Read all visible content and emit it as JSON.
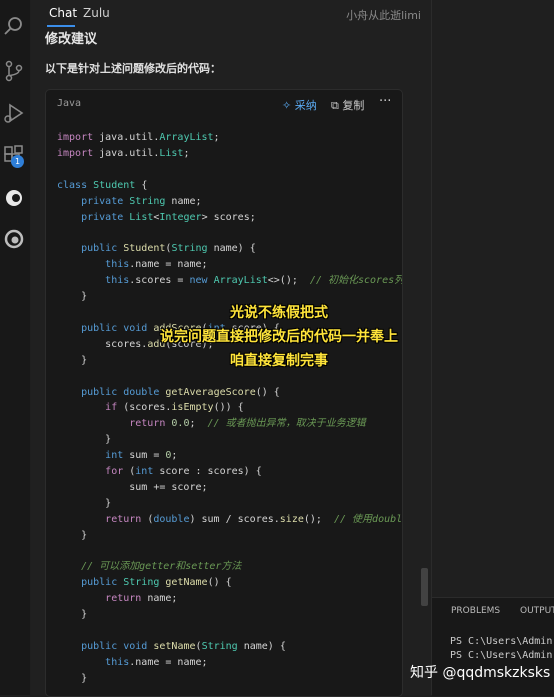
{
  "tabs": {
    "chat": "Chat",
    "zulu": "Zulu",
    "user": "小舟从此逝limi"
  },
  "chat": {
    "heading": "修改建议",
    "intro": "以下是针对上述问题修改后的代码：",
    "card": {
      "language": "Java",
      "apply": "采纳",
      "copy": "复制",
      "more": "···"
    }
  },
  "activity": {
    "badge": "1"
  },
  "panel": {
    "problems": "PROBLEMS",
    "output": "OUTPUT",
    "term1": "PS C:\\Users\\Admin",
    "term2": "PS C:\\Users\\Admin"
  },
  "overlay": {
    "line1": "光说不练假把式",
    "line2": "说完问题直接把修改后的代码一并奉上",
    "line3": "咱直接复制完事",
    "watermark": "知乎 @qqdmskzksks"
  },
  "colors": {
    "accent": "#3b8eea",
    "caption": "#ffe43a"
  }
}
